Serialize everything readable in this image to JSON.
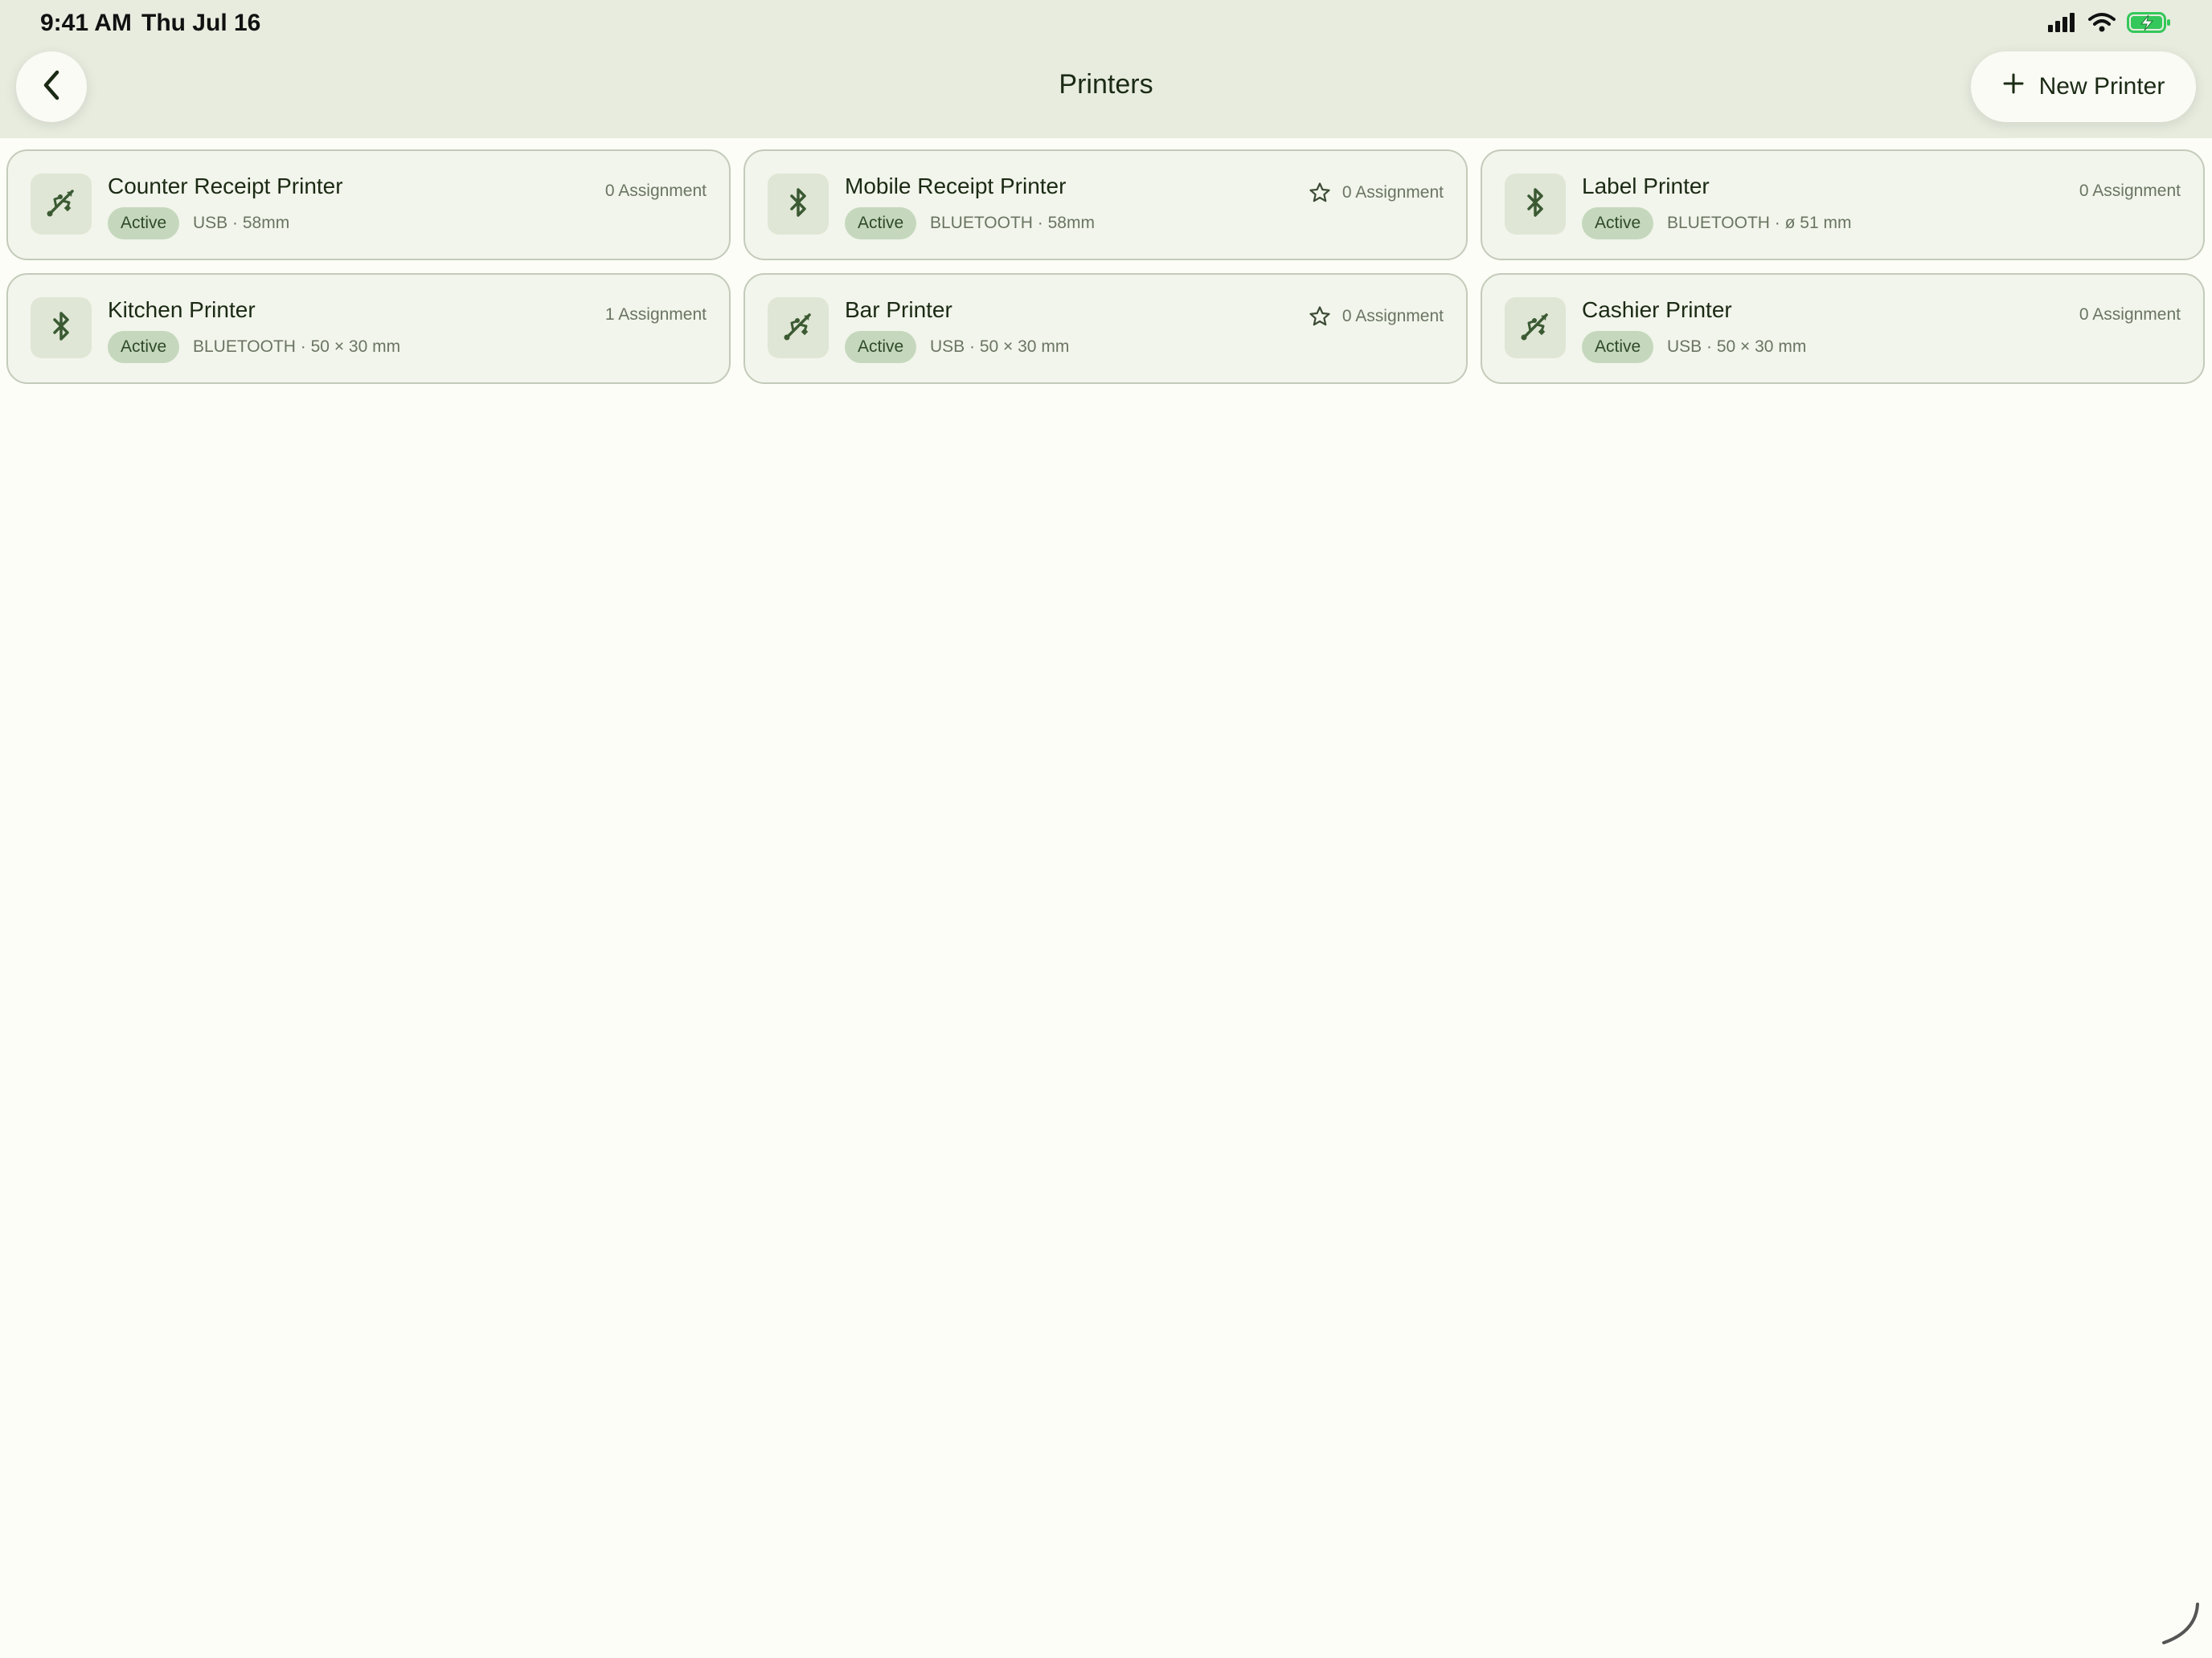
{
  "status_bar": {
    "time": "9:41 AM",
    "date": "Thu Jul 16"
  },
  "header": {
    "title": "Printers",
    "new_button_label": "New Printer"
  },
  "printers": [
    {
      "name": "Counter Receipt Printer",
      "status": "Active",
      "details": "USB · 58mm",
      "connection": "usb-icon",
      "assignments": "0 Assignment",
      "has_star": false
    },
    {
      "name": "Mobile Receipt Printer",
      "status": "Active",
      "details": "BLUETOOTH · 58mm",
      "connection": "bluetooth-icon",
      "assignments": "0 Assignment",
      "has_star": true
    },
    {
      "name": "Label Printer",
      "status": "Active",
      "details": "BLUETOOTH · ø 51 mm",
      "connection": "bluetooth-icon",
      "assignments": "0 Assignment",
      "has_star": false
    },
    {
      "name": "Kitchen Printer",
      "status": "Active",
      "details": "BLUETOOTH · 50 × 30 mm",
      "connection": "bluetooth-icon",
      "assignments": "1 Assignment",
      "has_star": false
    },
    {
      "name": "Bar Printer",
      "status": "Active",
      "details": "USB · 50 × 30 mm",
      "connection": "usb-icon",
      "assignments": "0 Assignment",
      "has_star": true
    },
    {
      "name": "Cashier Printer",
      "status": "Active",
      "details": "USB · 50 × 30 mm",
      "connection": "usb-icon",
      "assignments": "0 Assignment",
      "has_star": false
    }
  ],
  "colors": {
    "background": "#fcfdf6",
    "header_background": "#e7ecdf",
    "card_background": "#f2f5eb",
    "badge_background": "#c5d8bd",
    "accent_dark": "#3b5a33"
  }
}
